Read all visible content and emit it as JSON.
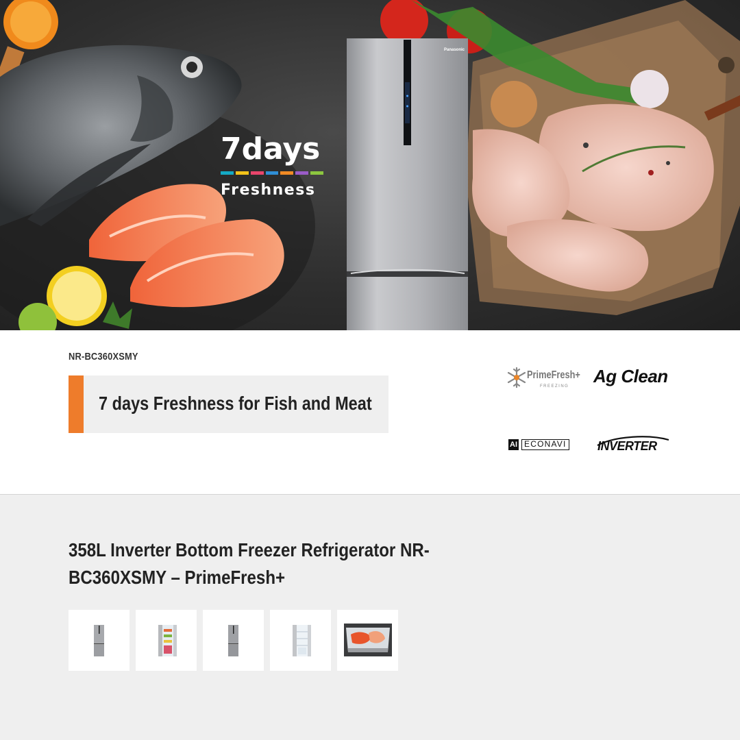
{
  "hero": {
    "headline_big": "7days",
    "headline_small": "Freshness",
    "bar_colors": [
      "#15a9c4",
      "#f3c21a",
      "#e9456c",
      "#2f8ed6",
      "#f08a24",
      "#9a5cc8",
      "#8cc63f"
    ],
    "fridge_brand": "Panasonic"
  },
  "info": {
    "model_code": "NR-BC360XSMY",
    "tagline": "7 days Freshness for Fish and Meat",
    "accent_color": "#ee7c2b",
    "logos": {
      "primefresh": "PrimeFresh+",
      "primefresh_sub": "FREEZING",
      "agclean": "Ag Clean",
      "ai": "AI",
      "econavi": "ECONAVI",
      "inverter": "INVERTER"
    }
  },
  "product": {
    "title_line1": "358L Inverter Bottom Freezer Refrigerator NR-",
    "title_line2": "BC360XSMY – PrimeFresh+",
    "thumbnails": [
      {
        "icon": "fridge-closed-icon"
      },
      {
        "icon": "fridge-open-icon"
      },
      {
        "icon": "fridge-closed-icon"
      },
      {
        "icon": "fridge-open-empty-icon"
      },
      {
        "icon": "freezer-drawer-food-icon"
      }
    ]
  }
}
